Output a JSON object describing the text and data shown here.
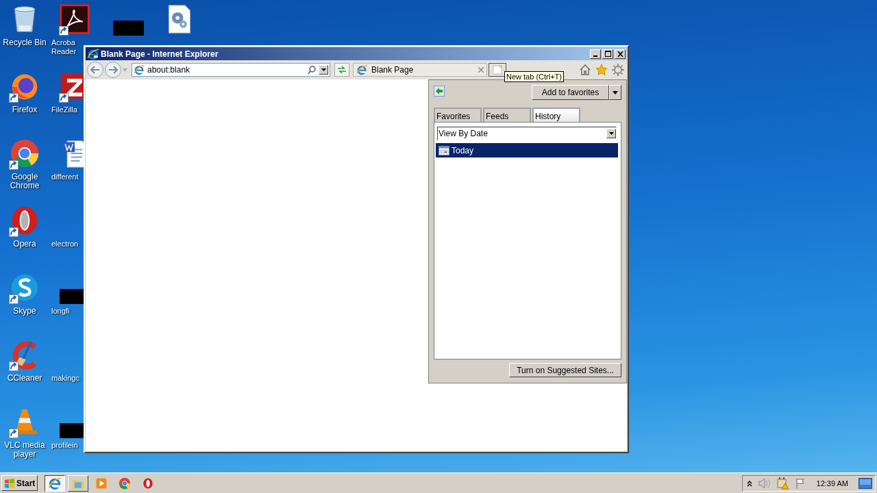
{
  "desktop": {
    "columns": [
      [
        {
          "kind": "recycle-bin",
          "label": "Recycle Bin",
          "shortcut": false
        },
        {
          "kind": "firefox",
          "label": "Firefox",
          "shortcut": true
        },
        {
          "kind": "chrome",
          "label": "Google Chrome",
          "shortcut": true
        },
        {
          "kind": "opera",
          "label": "Opera",
          "shortcut": true
        },
        {
          "kind": "skype",
          "label": "Skype",
          "shortcut": true
        },
        {
          "kind": "ccleaner",
          "label": "CCleaner",
          "shortcut": true
        },
        {
          "kind": "vlc",
          "label": "VLC media player",
          "shortcut": true
        }
      ],
      [
        {
          "kind": "acrobat",
          "label": "Acroba Reader",
          "shortcut": true
        },
        {
          "kind": "filezilla",
          "label": "FileZilla",
          "shortcut": true
        },
        {
          "kind": "word-doc",
          "label": "different",
          "shortcut": false
        },
        {
          "kind": "none",
          "label": "electron",
          "shortcut": false
        },
        {
          "kind": "redacted",
          "label": "longfi",
          "shortcut": false
        },
        {
          "kind": "none",
          "label": "makingc",
          "shortcut": false
        },
        {
          "kind": "redacted",
          "label": "profilein",
          "shortcut": false
        }
      ],
      [
        {
          "kind": "redacted",
          "shortcut": false
        }
      ],
      [
        {
          "kind": "settings-file",
          "shortcut": false
        }
      ]
    ]
  },
  "browser": {
    "title": "Blank Page - Internet Explorer",
    "address": "about:blank",
    "tabs": [
      {
        "label": "Blank Page",
        "selected": true
      }
    ],
    "tooltip": "New tab (Ctrl+T)",
    "favorites_center": {
      "add_button": "Add to favorites",
      "tabs": [
        {
          "label": "Favorites",
          "selected": false
        },
        {
          "label": "Feeds",
          "selected": false
        },
        {
          "label": "History",
          "selected": true
        }
      ],
      "view": "View By Date",
      "items": [
        {
          "label": "Today",
          "selected": true
        }
      ],
      "suggest_button": "Turn on Suggested Sites..."
    }
  },
  "taskbar": {
    "start": "Start",
    "items": [
      {
        "kind": "ie",
        "running": true,
        "active": true
      },
      {
        "kind": "explorer",
        "running": true,
        "active": false
      },
      {
        "kind": "media-player",
        "running": false,
        "active": false
      },
      {
        "kind": "chrome",
        "running": false,
        "active": false
      },
      {
        "kind": "opera",
        "running": false,
        "active": false
      }
    ],
    "clock": "12:39 AM"
  }
}
